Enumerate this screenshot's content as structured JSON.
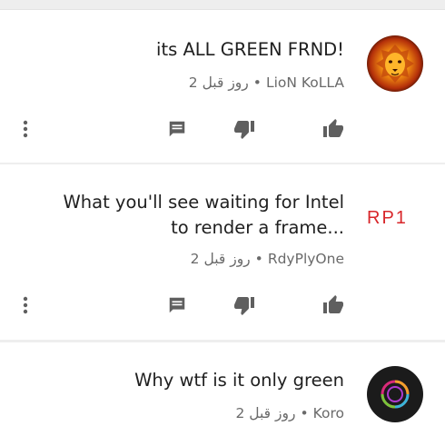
{
  "comments": [
    {
      "text": "its ALL GREEN FRND!",
      "author": "LioN KoLLA",
      "separator": "•",
      "time": "2 روز قبل",
      "avatar": "lion-avatar"
    },
    {
      "text": "What you'll see waiting for Intel\nto render a frame...",
      "author": "RdyPlyOne",
      "separator": "•",
      "time": "2 روز قبل",
      "avatar": "rp1-logo",
      "logo_text": "RP1"
    },
    {
      "text": "Why wtf is it only green",
      "author": "Koro",
      "separator": "•",
      "time": "2 روز قبل",
      "avatar": "circle-logo-avatar"
    }
  ],
  "icons": {
    "like": "thumbs-up-icon",
    "dislike": "thumbs-down-icon",
    "reply": "comment-icon",
    "more": "more-vertical-icon"
  },
  "colors": {
    "text": "#202020",
    "meta": "#6a6a6a",
    "icon": "#5f5f5f",
    "logo_red": "#d8262a",
    "background": "#eeeeee"
  }
}
